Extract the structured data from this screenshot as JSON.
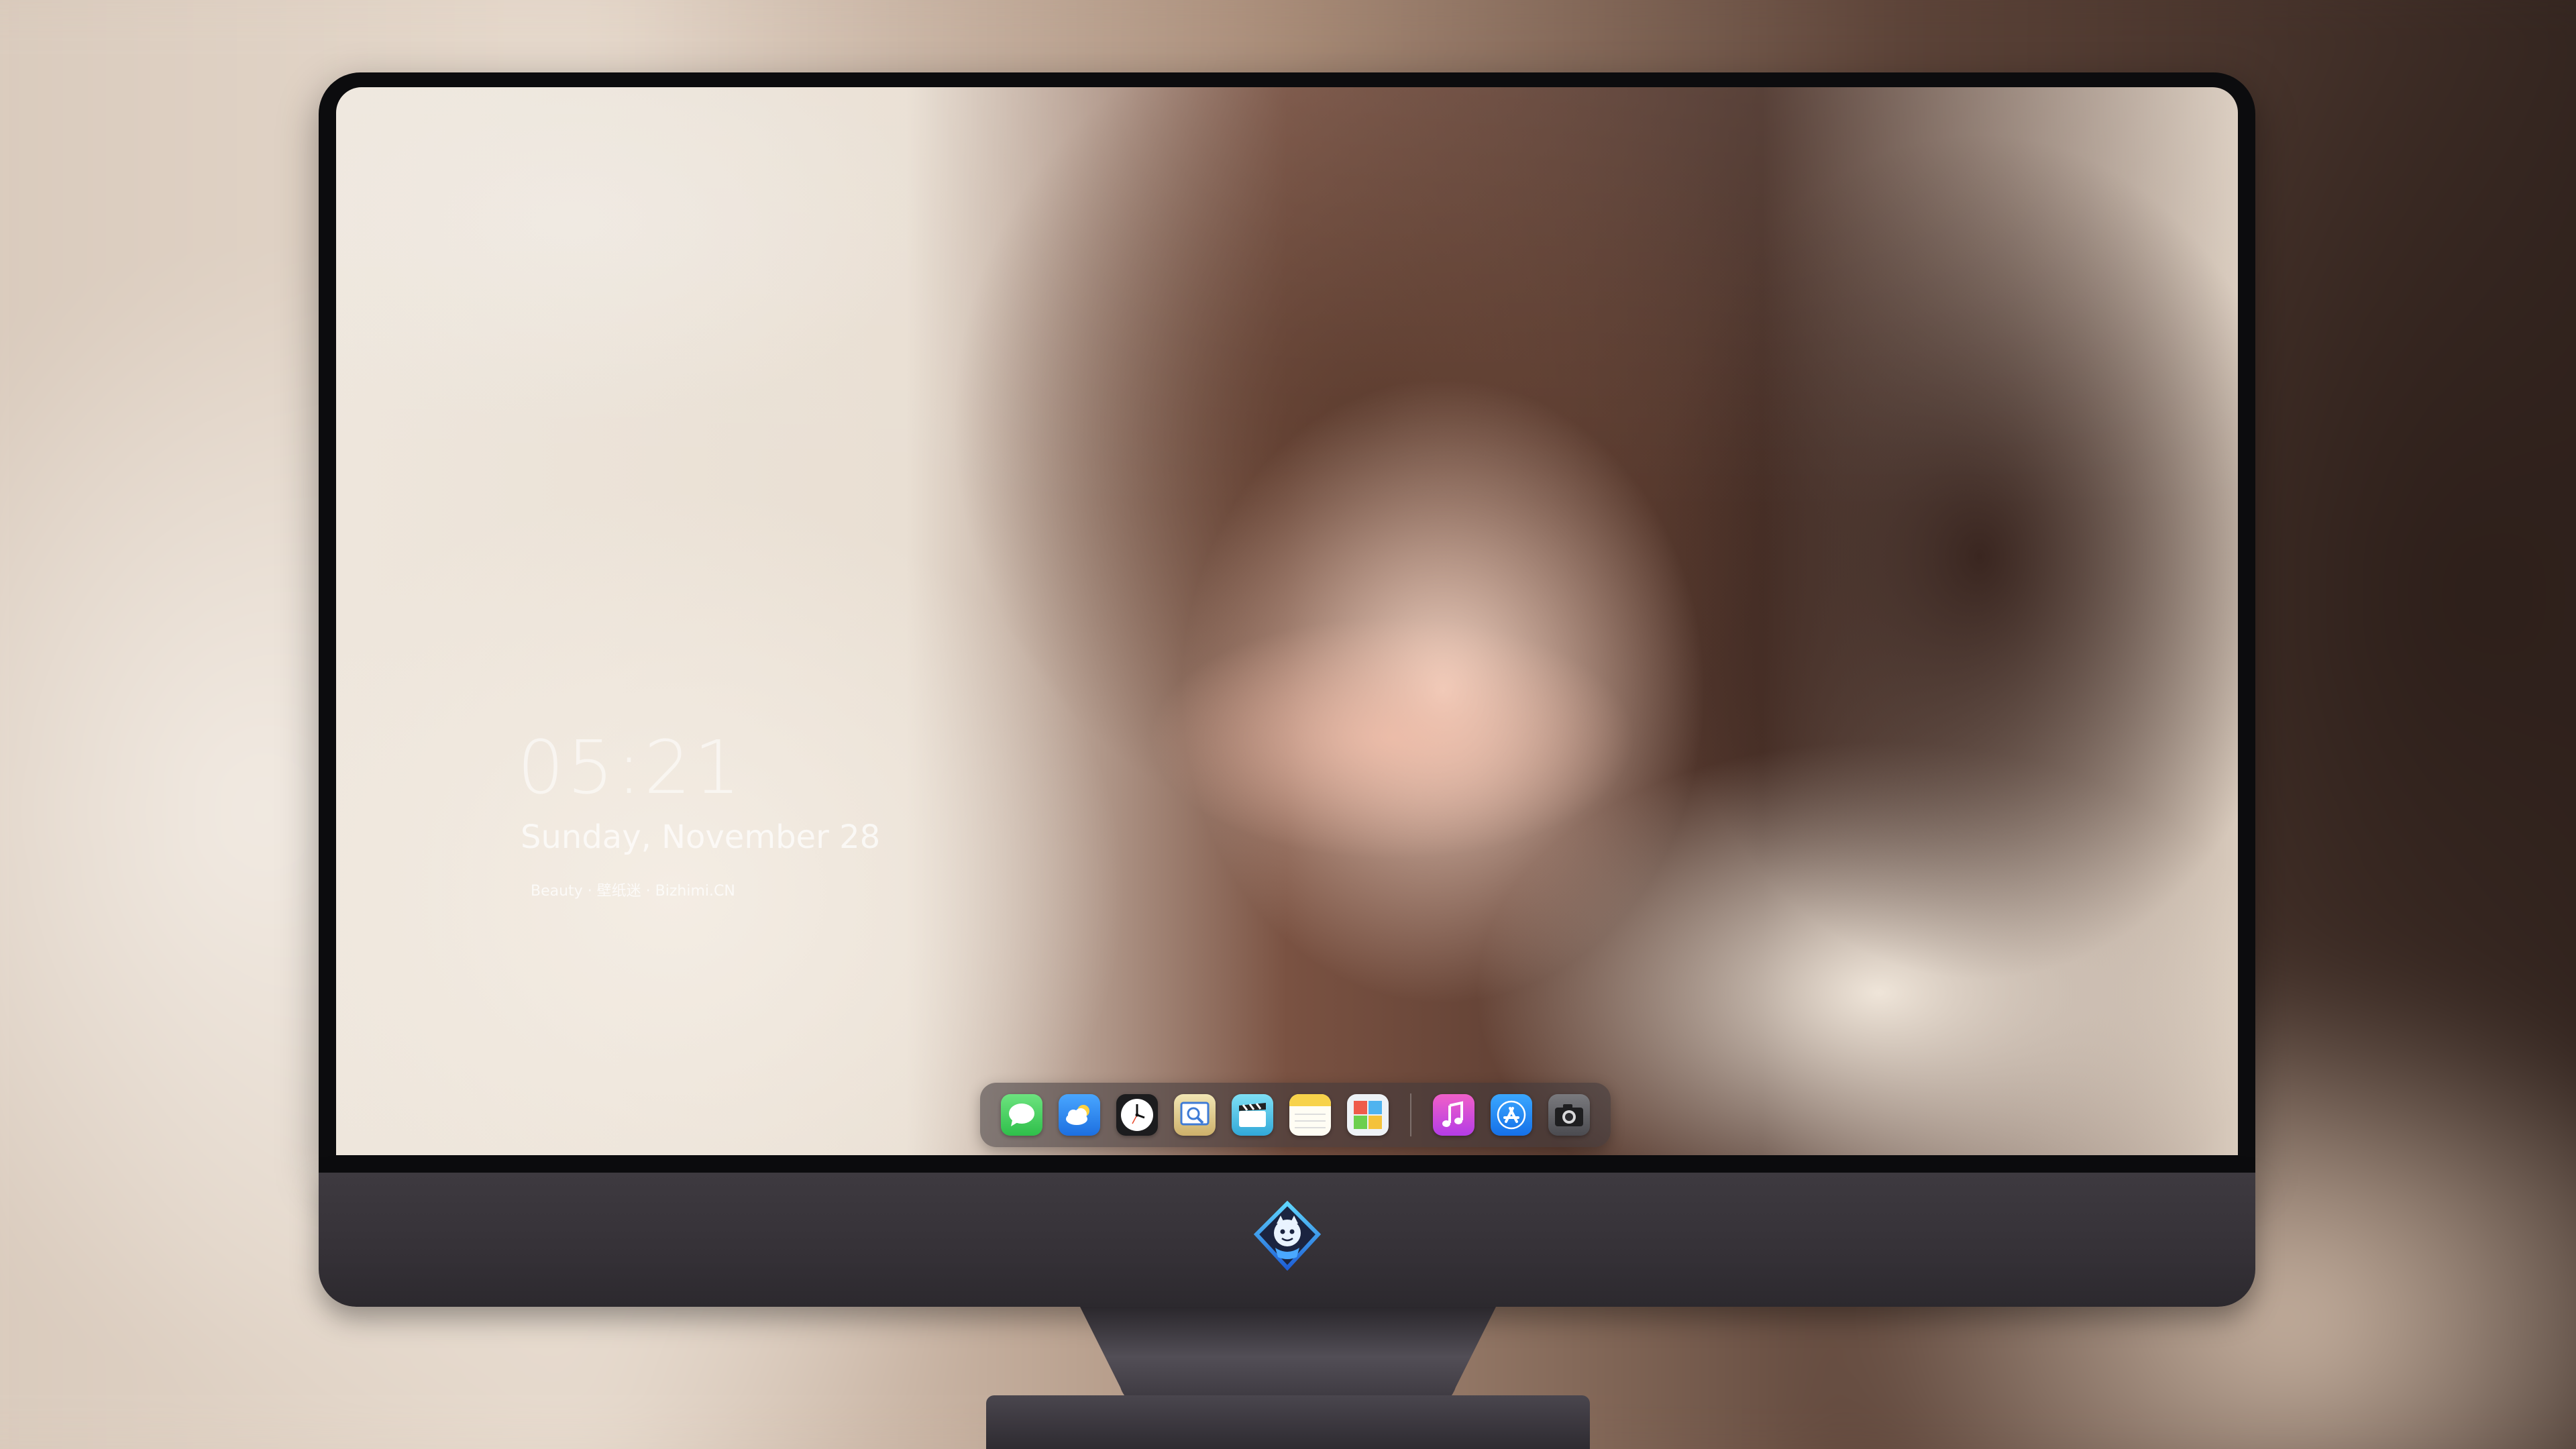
{
  "lock_screen": {
    "time": "05:21",
    "date": "Sunday, November 28",
    "credit": "Beauty · 壁纸迷 · Bizhimi.CN"
  },
  "dock": {
    "apps": [
      {
        "name": "Messages",
        "icon": "messages-icon",
        "color": "#3ecf5a"
      },
      {
        "name": "Weather",
        "icon": "weather-icon",
        "color": "#2f8ef4"
      },
      {
        "name": "Clock",
        "icon": "clock-icon",
        "color": "#1c1c1e"
      },
      {
        "name": "Preview",
        "icon": "preview-icon",
        "color": "#d8c07a"
      },
      {
        "name": "Clips",
        "icon": "clips-icon",
        "color": "#4fc7e8"
      },
      {
        "name": "Notes",
        "icon": "notes-icon",
        "color": "#f7d24a"
      },
      {
        "name": "Photo Booth",
        "icon": "photo-booth-icon",
        "color": "#e9eef3"
      },
      {
        "name": "Music",
        "icon": "music-icon",
        "color": "#d94be0"
      },
      {
        "name": "App Store",
        "icon": "app-store-icon",
        "color": "#1e8af2"
      },
      {
        "name": "Camera",
        "icon": "camera-icon",
        "color": "#5a5a5e"
      }
    ]
  },
  "colors": {
    "bezel": "#0c0c0e",
    "chin": "#3e3a40",
    "dock_bg": "#3c363a"
  }
}
